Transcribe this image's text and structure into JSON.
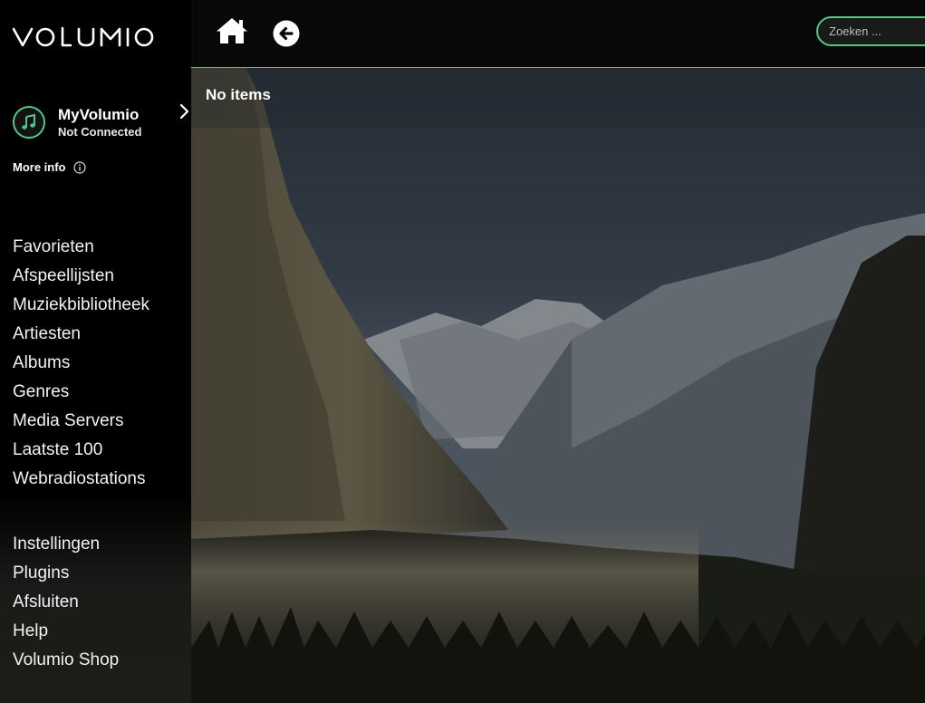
{
  "app": {
    "logo_text": "volumio"
  },
  "myvolumio": {
    "name": "MyVolumio",
    "status": "Not Connected",
    "more_info": "More info"
  },
  "nav_primary": [
    {
      "label": "Favorieten"
    },
    {
      "label": "Afspeellijsten"
    },
    {
      "label": "Muziekbibliotheek"
    },
    {
      "label": "Artiesten"
    },
    {
      "label": "Albums"
    },
    {
      "label": "Genres"
    },
    {
      "label": "Media Servers"
    },
    {
      "label": "Laatste 100"
    },
    {
      "label": "Webradiostations"
    }
  ],
  "nav_secondary": [
    {
      "label": "Instellingen"
    },
    {
      "label": "Plugins"
    },
    {
      "label": "Afsluiten"
    },
    {
      "label": "Help"
    },
    {
      "label": "Volumio Shop"
    }
  ],
  "search": {
    "placeholder": "Zoeken ...",
    "value": ""
  },
  "main": {
    "empty_text": "No items"
  },
  "icons": {
    "home": "home-icon",
    "back": "back-arrow-icon",
    "music": "music-note-icon",
    "chevron": "chevron-right-icon",
    "info": "info-icon"
  },
  "colors": {
    "accent": "#54c688",
    "sidebar_bg": "#000000",
    "topbar_bg": "#080808"
  }
}
